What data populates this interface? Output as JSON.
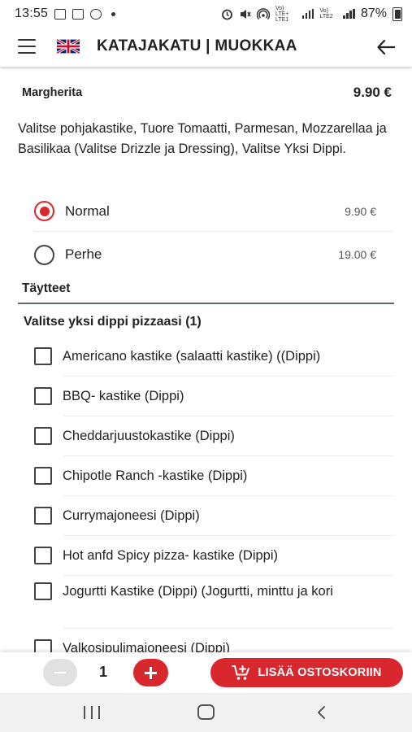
{
  "status_bar": {
    "time": "13:55",
    "network_label_1": "Vo) LTE+ LTE1",
    "network_label_2": "Vo) LTE2",
    "battery": "87%"
  },
  "header": {
    "title": "KATAJAKATU | MUOKKAA",
    "menu_icon": "hamburger-menu-icon",
    "language_icon": "uk-flag-icon",
    "back_icon": "arrow-left-icon"
  },
  "product": {
    "name": "Margherita",
    "price": "9.90 €",
    "description": "Valitse pohjakastike, Tuore Tomaatti, Parmesan, Mozzarellaa ja Basilikaa (Valitse Drizzle ja Dressing), Valitse Yksi Dippi."
  },
  "sizes": [
    {
      "label": "Normal",
      "price": "9.90 €",
      "selected": true
    },
    {
      "label": "Perhe",
      "price": "19.00 €",
      "selected": false
    }
  ],
  "toppings_section": {
    "title": "Täytteet",
    "group_title": "Valitse yksi dippi pizzaasi (1)",
    "options": [
      "Americano kastike (salaatti kastike) ((Dippi)",
      "BBQ- kastike (Dippi)",
      "Cheddarjuustokastike (Dippi)",
      "Chipotle Ranch -kastike (Dippi)",
      "Currymajoneesi (Dippi)",
      "Hot anfd Spicy pizza- kastike (Dippi)",
      "Jogurtti Kastike (Dippi) (Jogurtti, minttu ja kori",
      "Valkosipulimajoneesi (Dippi)"
    ]
  },
  "cart": {
    "quantity": "1",
    "add_label": "LISÄÄ OSTOSKORIIN",
    "minus_icon": "minus-icon",
    "plus_icon": "plus-icon",
    "cart_icon": "cart-add-icon"
  },
  "colors": {
    "accent": "#d9272e",
    "divider": "#5b6c6c",
    "disabled": "#e1e1e1"
  }
}
